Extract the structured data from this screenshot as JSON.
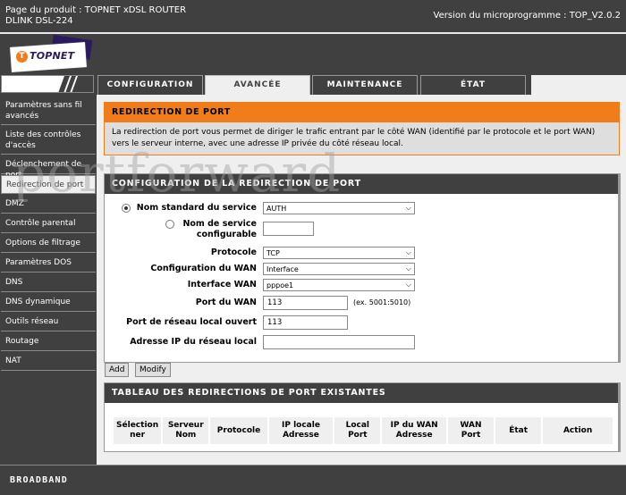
{
  "header": {
    "product_line1": "Page du produit : TOPNET xDSL ROUTER",
    "product_line2": "DLINK DSL-224",
    "firmware": "Version du microprogramme : TOP_V2.0.2"
  },
  "logo": {
    "text": "TOPNET",
    "mark": "T",
    "brand_color": "#f07d1a",
    "brand_dark": "#2b1a5e"
  },
  "tabs": [
    {
      "label": "CONFIGURATION",
      "active": false
    },
    {
      "label": "AVANCÉE",
      "active": true
    },
    {
      "label": "MAINTENANCE",
      "active": false
    },
    {
      "label": "ÉTAT",
      "active": false
    }
  ],
  "sidebar": {
    "items": [
      {
        "label": "Paramètres sans fil avancés"
      },
      {
        "label": "Liste des contrôles d'accès"
      },
      {
        "label": "Déclenchement de port"
      },
      {
        "label": "Redirection de port",
        "active": true
      },
      {
        "label": "DMZ"
      },
      {
        "label": "Contrôle parental"
      },
      {
        "label": "Options de filtrage"
      },
      {
        "label": "Paramètres DOS"
      },
      {
        "label": "DNS"
      },
      {
        "label": "DNS dynamique"
      },
      {
        "label": "Outils réseau"
      },
      {
        "label": "Routage"
      },
      {
        "label": "NAT"
      }
    ]
  },
  "intro": {
    "title": "REDIRECTION DE PORT",
    "description": "La redirection de port vous permet de diriger le trafic entrant par le côté WAN (identifié par le protocole et le port WAN) vers le serveur interne, avec une adresse IP privée du côté réseau local."
  },
  "config": {
    "title": "CONFIGURATION DE LA REDIRECTION DE PORT",
    "standard_service_label": "Nom standard du service",
    "standard_service_value": "AUTH",
    "standard_service_selected": true,
    "custom_service_label_1": "Nom de service",
    "custom_service_label_2": "configurable",
    "custom_service_value": "",
    "protocol_label": "Protocole",
    "protocol_value": "TCP",
    "wan_config_label": "Configuration du WAN",
    "wan_config_value": "Interface",
    "wan_interface_label": "Interface WAN",
    "wan_interface_value": "pppoe1",
    "wan_port_label": "Port du WAN",
    "wan_port_value": "113",
    "wan_port_hint": "(ex. 5001:5010)",
    "lan_port_label": "Port de réseau local ouvert",
    "lan_port_value": "113",
    "lan_ip_label": "Adresse IP du réseau local",
    "lan_ip_value": ""
  },
  "buttons": {
    "add": "Add",
    "modify": "Modify"
  },
  "table": {
    "title": "TABLEAU DES REDIRECTIONS DE PORT EXISTANTES",
    "columns": [
      {
        "line1": "Sélection",
        "line2": "ner"
      },
      {
        "line1": "Serveur",
        "line2": "Nom"
      },
      {
        "line1": "Protocole",
        "line2": ""
      },
      {
        "line1": "IP locale",
        "line2": "Adresse"
      },
      {
        "line1": "Local",
        "line2": "Port"
      },
      {
        "line1": "IP du WAN",
        "line2": "Adresse"
      },
      {
        "line1": "WAN",
        "line2": "Port"
      },
      {
        "line1": "État",
        "line2": ""
      },
      {
        "line1": "Action",
        "line2": ""
      }
    ],
    "rows": []
  },
  "watermark": "portforward",
  "footer": {
    "brand": "BROADBAND"
  }
}
